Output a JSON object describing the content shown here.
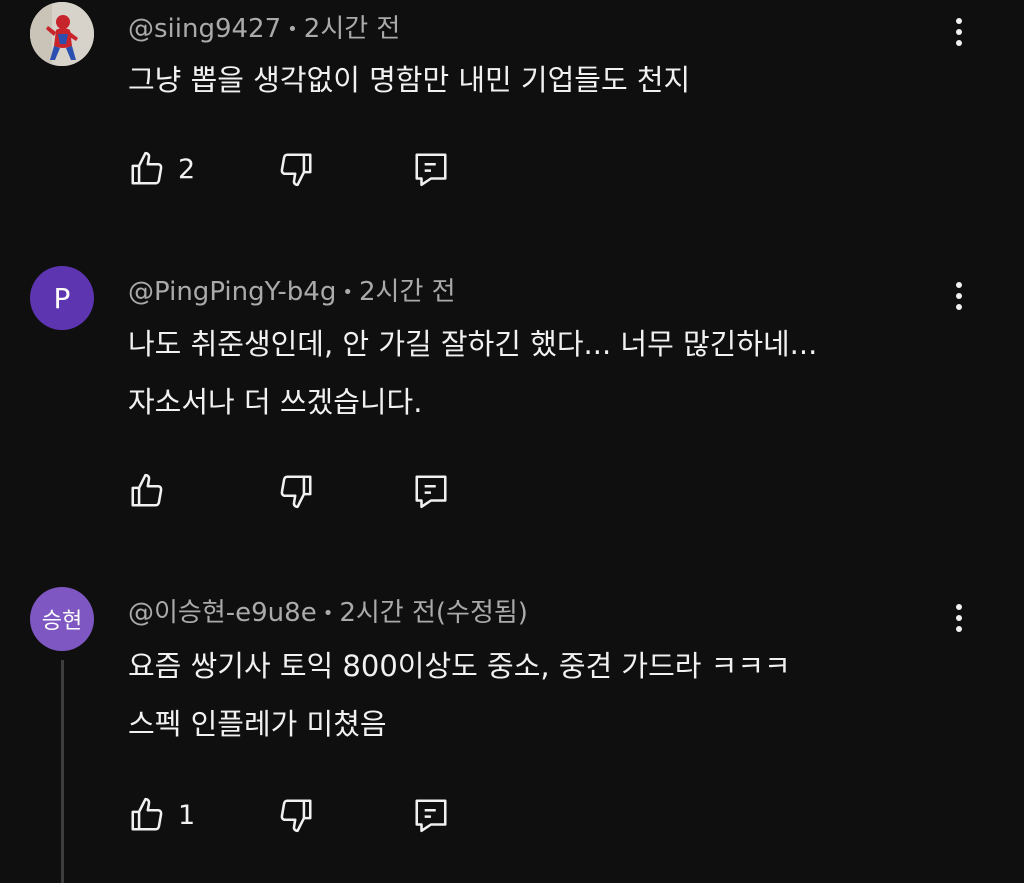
{
  "comments": [
    {
      "author": "@siing9427",
      "time": "2시간 전",
      "lines": [
        "그냥 뽑을 생각없이 명함만 내민 기업들도 천지"
      ],
      "likes": "2",
      "avatar": {
        "type": "photo",
        "letter": ""
      }
    },
    {
      "author": "@PingPingY-b4g",
      "time": "2시간 전",
      "lines": [
        "나도 취준생인데, 안 가길 잘하긴 했다... 너무 많긴하네...",
        "자소서나 더 쓰겠습니다."
      ],
      "likes": "",
      "avatar": {
        "type": "letter",
        "letter": "P",
        "color": "#5e35b1"
      }
    },
    {
      "author": "@이승현-e9u8e",
      "time": "2시간 전(수정됨)",
      "lines": [
        "요즘 쌍기사 토익 800이상도 중소, 중견 가드라 ㅋㅋㅋ",
        "스펙 인플레가 미쳤음"
      ],
      "likes": "1",
      "avatar": {
        "type": "letter",
        "letter": "승현",
        "color": "#7e57c2"
      }
    }
  ],
  "separator": "•",
  "icons": {
    "like": "thumbs-up-icon",
    "dislike": "thumbs-down-icon",
    "reply": "reply-icon",
    "menu": "more-vert-icon"
  }
}
